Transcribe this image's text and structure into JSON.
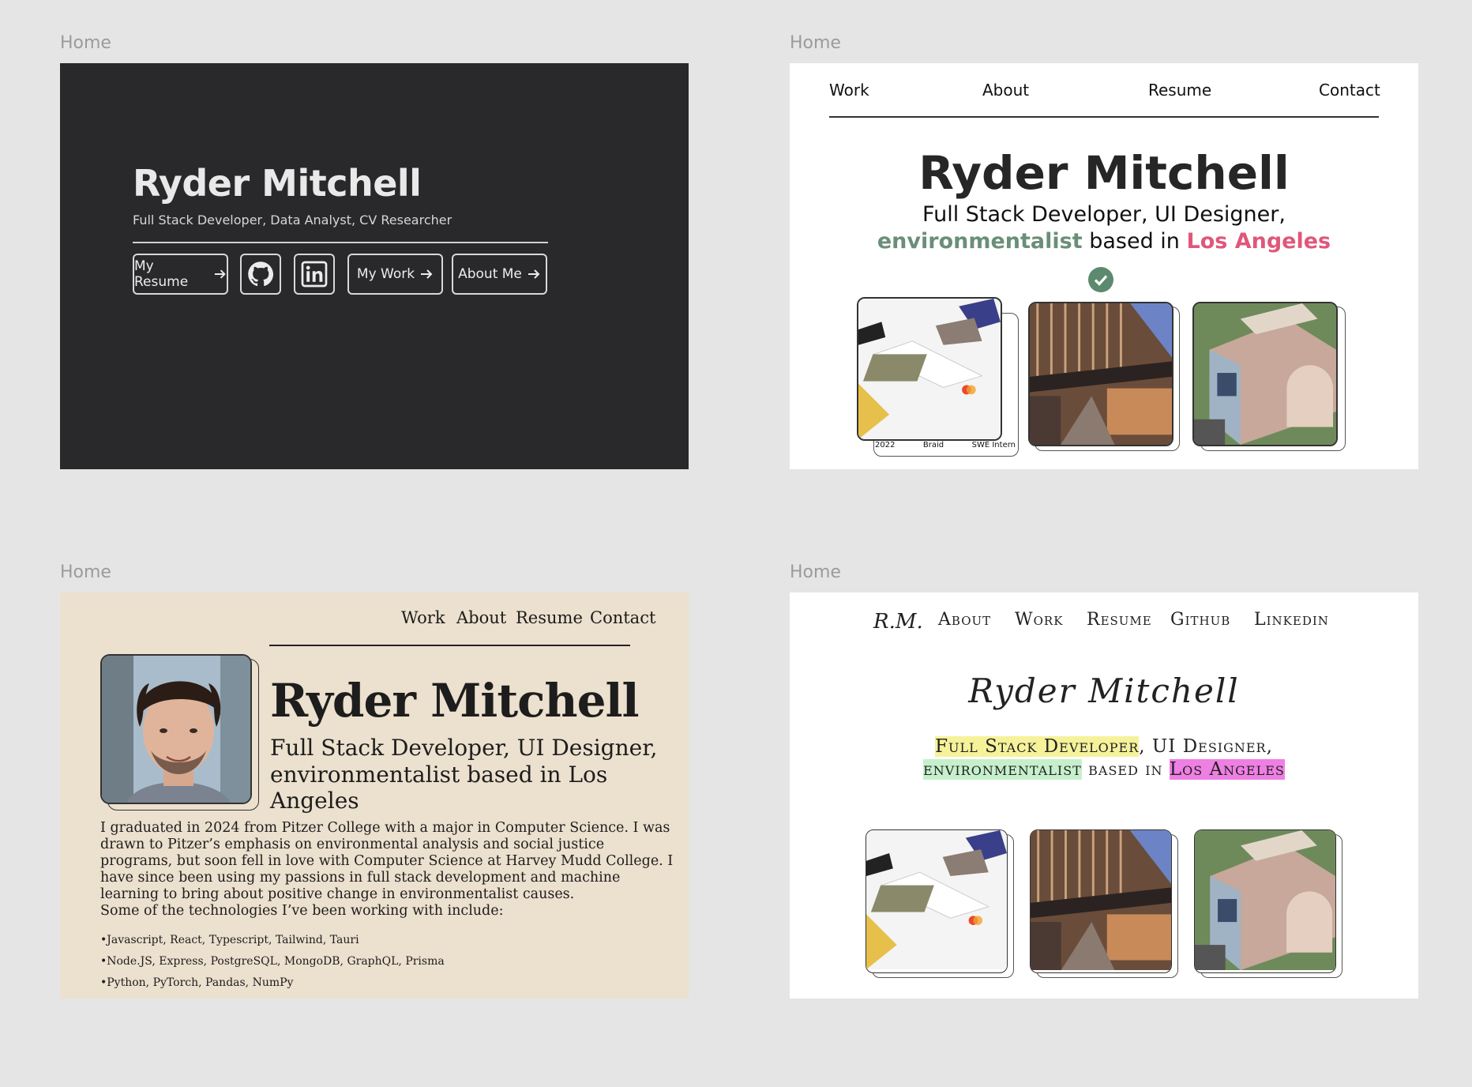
{
  "frames": {
    "f1_label": "Home",
    "f2_label": "Home",
    "f3_label": "Home",
    "f4_label": "Home"
  },
  "dark": {
    "name": "Ryder Mitchell",
    "subtitle": "Full Stack Developer, Data Analyst, CV Researcher",
    "resume_btn": "My Resume",
    "work_btn": "My Work",
    "about_btn": "About Me",
    "github_icon": "github-icon",
    "linkedin_icon": "linkedin-icon"
  },
  "light": {
    "nav": [
      "Work",
      "About",
      "Resume",
      "Contact"
    ],
    "name": "Ryder Mitchell",
    "line1": "Full Stack Developer, UI Designer,",
    "line2_a": "environmentalist",
    "line2_b": " based in ",
    "line2_c": "Los Angeles",
    "card1_meta": [
      "2022",
      "Braid",
      "SWE Intern"
    ],
    "colors": {
      "green": "#6b8e78",
      "pink": "#e0577a",
      "check": "#5b8a6e"
    }
  },
  "serif": {
    "nav": [
      "Work",
      "About",
      "Resume",
      "Contact"
    ],
    "name": "Ryder Mitchell",
    "role1": "Full Stack Developer, UI Designer,",
    "role2": "environmentalist based in Los Angeles",
    "bio1": "I graduated in 2024 from Pitzer College with a major in Computer Science. I was drawn to Pitzer’s emphasis on environmental analysis and social justice programs, but soon fell in love with Computer Science at Harvey Mudd College. I have since been using my passions in full stack development and machine learning to bring about positive change in environmentalist causes.",
    "bio2": "Some of the technologies I’ve been working with include:",
    "techs": [
      "•Javascript, React, Typescript, Tailwind, Tauri",
      "•Node.JS, Express, PostgreSQL, MongoDB, GraphQL, Prisma",
      "•Python, PyTorch, Pandas, NumPy"
    ],
    "bg": "#ece0ce"
  },
  "script": {
    "mono": "R.M.",
    "nav": [
      "About",
      "Work",
      "Resume",
      "Github",
      "Linkedin"
    ],
    "name": "Ryder Mitchell",
    "l1_a": "Full Stack Developer",
    "l1_b": ", UI Designer,",
    "l2_a": "environmentalist",
    "l2_b": " based in ",
    "l2_c": "Los Angeles",
    "highlights": {
      "yellow": "#f6f29a",
      "green": "#c6f0cc",
      "pink": "#ee7fe3"
    }
  }
}
